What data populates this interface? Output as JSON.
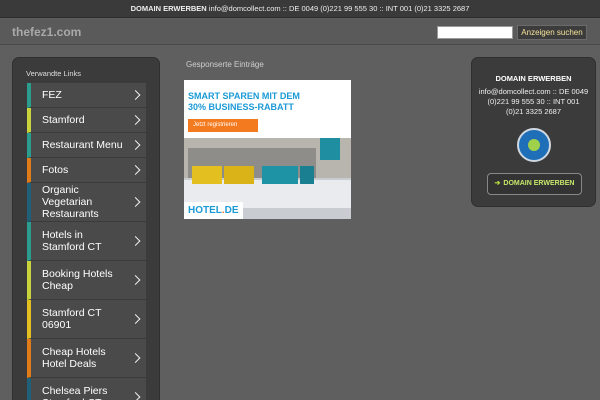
{
  "topbar": {
    "label": "DOMAIN ERWERBEN",
    "contact": "info@domcollect.com :: DE 0049 (0)221 99 555 30 :: INT 001 (0)21 3325 2687"
  },
  "header": {
    "logo": "thefez1.com",
    "search_value": "",
    "search_button": "Anzeigen suchen"
  },
  "sidebar": {
    "title": "Verwandte Links",
    "items": [
      {
        "label": "FEZ",
        "color": "#2a9d8f",
        "height": 24
      },
      {
        "label": "Stamford",
        "color": "#c9d33b",
        "height": 24
      },
      {
        "label": "Restaurant Menu",
        "color": "#2a9d8f",
        "height": 24
      },
      {
        "label": "Fotos",
        "color": "#e07b1a",
        "height": 24
      },
      {
        "label": "Organic Vegetarian Restaurants",
        "color": "#1f5f78",
        "height": 38
      },
      {
        "label": "Hotels in Stamford CT",
        "color": "#2a9d8f",
        "height": 38
      },
      {
        "label": "Booking Hotels Cheap",
        "color": "#c9d33b",
        "height": 38
      },
      {
        "label": "Stamford CT 06901",
        "color": "#e3c020",
        "height": 38
      },
      {
        "label": "Cheap Hotels Hotel Deals",
        "color": "#e07b1a",
        "height": 38
      },
      {
        "label": "Chelsea Piers Stamford CT",
        "color": "#1f5f78",
        "height": 38
      }
    ]
  },
  "main": {
    "sponsored_title": "Gesponserte Einträge",
    "ad": {
      "headline_line1": "SMART SPAREN MIT DEM",
      "headline_line2": "30% BUSINESS-RABATT",
      "cta": "Jetzt registrieren",
      "brand_part1": "HOTEL",
      "brand_part2": "DE"
    }
  },
  "right_box": {
    "title": "DOMAIN ERWERBEN",
    "contact": "info@domcollect.com :: DE 0049 (0)221 99 555 30 :: INT 001 (0)21 3325 2687",
    "button": "DOMAIN ERWERBEN"
  }
}
